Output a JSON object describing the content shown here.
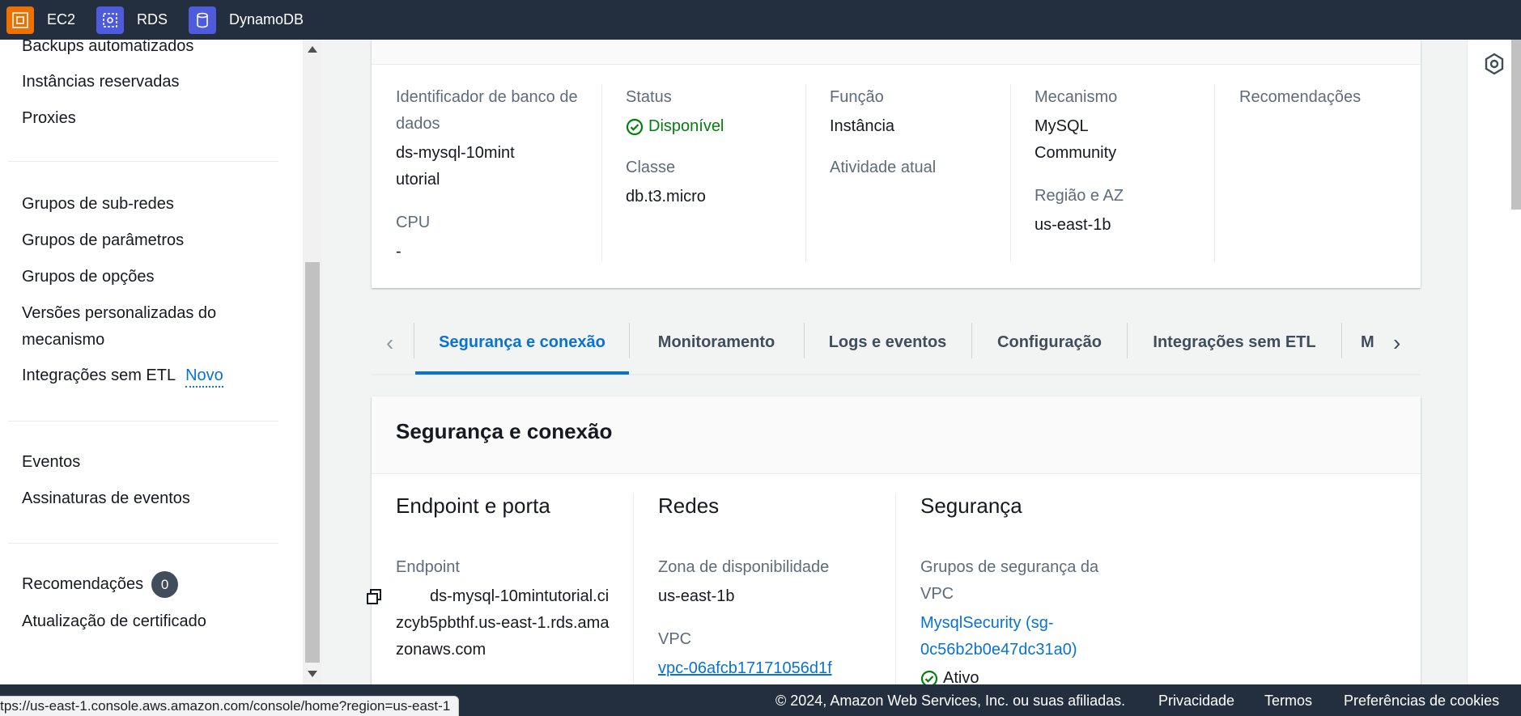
{
  "topbar": {
    "favorites": [
      {
        "label": "EC2",
        "icon": "ec2-icon",
        "color": "#ed7100"
      },
      {
        "label": "RDS",
        "icon": "rds-icon",
        "color": "#4d5bdc"
      },
      {
        "label": "DynamoDB",
        "icon": "dynamodb-icon",
        "color": "#4d5bdc"
      }
    ]
  },
  "sidebar": {
    "items": [
      {
        "label": "Backups automatizados"
      },
      {
        "label": "Instâncias reservadas"
      },
      {
        "label": "Proxies"
      },
      {
        "label": "Grupos de sub-redes"
      },
      {
        "label": "Grupos de parâmetros"
      },
      {
        "label": "Grupos de opções"
      },
      {
        "label": "Versões personalizadas do mecanismo"
      },
      {
        "label": "Integrações sem ETL",
        "badge": "Novo"
      },
      {
        "label": "Eventos"
      },
      {
        "label": "Assinaturas de eventos"
      },
      {
        "label": "Recomendações",
        "count": "0"
      },
      {
        "label": "Atualização de certificado"
      }
    ]
  },
  "summary": {
    "db_identifier_label": "Identificador de banco de dados",
    "db_identifier_value": "ds-mysql-10mintutorial",
    "cpu_label": "CPU",
    "cpu_value": "-",
    "status_label": "Status",
    "status_value": "Disponível",
    "class_label": "Classe",
    "class_value": "db.t3.micro",
    "role_label": "Função",
    "role_value": "Instância",
    "activity_label": "Atividade atual",
    "engine_label": "Mecanismo",
    "engine_value": "MySQL Community",
    "region_label": "Região e AZ",
    "region_value": "us-east-1b",
    "recommendations_label": "Recomendações"
  },
  "tabs": [
    {
      "label": "Segurança e conexão",
      "active": true
    },
    {
      "label": "Monitoramento"
    },
    {
      "label": "Logs e eventos"
    },
    {
      "label": "Configuração"
    },
    {
      "label": "Integrações sem ETL"
    },
    {
      "label": "M"
    }
  ],
  "security_section": {
    "title": "Segurança e conexão",
    "endpoint": {
      "title": "Endpoint e porta",
      "endpoint_label": "Endpoint",
      "endpoint_value": "ds-mysql-10mintutorial.cizcyb5pbthf.us-east-1.rds.amazonaws.com"
    },
    "networking": {
      "title": "Redes",
      "az_label": "Zona de disponibilidade",
      "az_value": "us-east-1b",
      "vpc_label": "VPC",
      "vpc_value": "vpc-06afcb17171056d1f"
    },
    "security": {
      "title": "Segurança",
      "sg_label": "Grupos de segurança da VPC",
      "sg_value": "MysqlSecurity (sg-0c56b2b0e47dc31a0)",
      "sg_status": "Ativo"
    }
  },
  "footer": {
    "copyright": "© 2024, Amazon Web Services, Inc. ou suas afiliadas.",
    "privacy": "Privacidade",
    "terms": "Termos",
    "cookies": "Preferências de cookies"
  },
  "status_url": "https://us-east-1.console.aws.amazon.com/console/home?region=us-east-1"
}
